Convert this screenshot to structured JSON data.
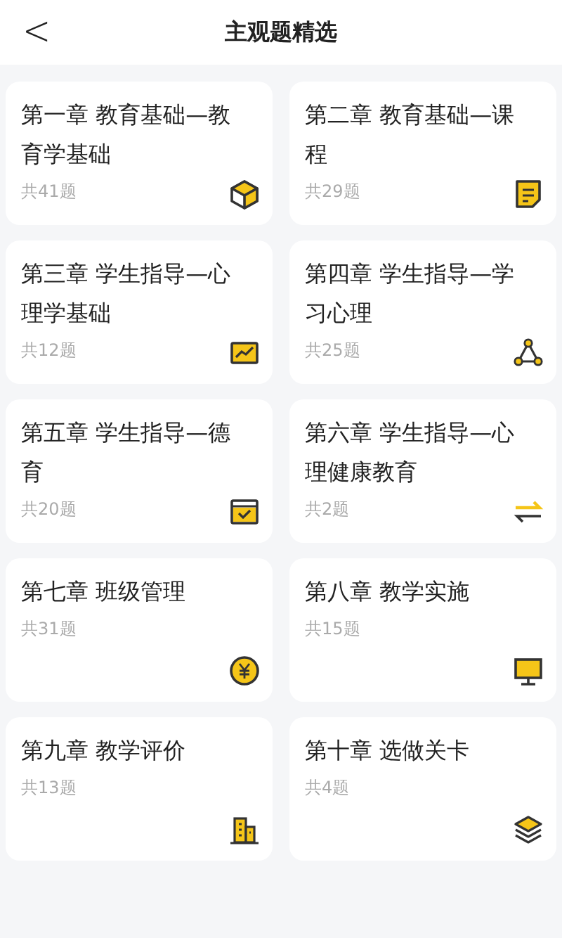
{
  "header": {
    "back": "<",
    "title": "主观题精选"
  },
  "chapters": [
    {
      "title": "第一章 教育基础—教育学基础",
      "count": "共41题"
    },
    {
      "title": "第二章 教育基础—课程",
      "count": "共29题"
    },
    {
      "title": "第三章 学生指导—心理学基础",
      "count": "共12题"
    },
    {
      "title": "第四章 学生指导—学习心理",
      "count": "共25题"
    },
    {
      "title": "第五章 学生指导—德育",
      "count": "共20题"
    },
    {
      "title": "第六章 学生指导—心理健康教育",
      "count": "共2题"
    },
    {
      "title": "第七章 班级管理",
      "count": "共31题"
    },
    {
      "title": "第八章 教学实施",
      "count": "共15题"
    },
    {
      "title": "第九章 教学评价",
      "count": "共13题"
    },
    {
      "title": "第十章 选做关卡",
      "count": "共4题"
    }
  ]
}
